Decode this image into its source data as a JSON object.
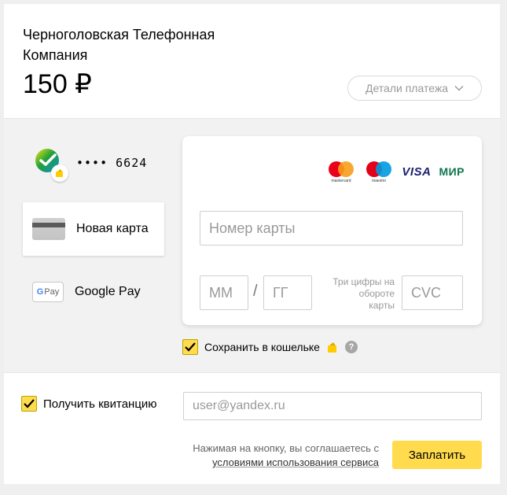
{
  "header": {
    "merchant_name": "Черноголовская Телефонная Компания",
    "amount": "150 ₽",
    "details_label": "Детали платежа"
  },
  "methods": {
    "saved_card": {
      "mask": "•••• 6624",
      "icon": "sberbank-icon"
    },
    "new_card": {
      "label": "Новая карта",
      "icon": "bank-card-icon"
    },
    "google_pay": {
      "label": "Google Pay",
      "icon_text": "Pay",
      "icon": "google-pay-icon"
    }
  },
  "card_form": {
    "brands": {
      "mastercard": "mastercard",
      "maestro": "maestro",
      "visa": "VISA",
      "mir": "МИР"
    },
    "number_placeholder": "Номер карты",
    "month_placeholder": "ММ",
    "separator": "/",
    "year_placeholder": "ГГ",
    "cvc_hint": "Три цифры на обороте карты",
    "cvc_placeholder": "CVC"
  },
  "save_wallet": {
    "label": "Сохранить в кошельке",
    "checked": true,
    "help": "?"
  },
  "receipt": {
    "label": "Получить квитанцию",
    "checked": true,
    "email_placeholder": "user@yandex.ru"
  },
  "footer": {
    "agree_text": "Нажимая на кнопку, вы соглашаетесь с",
    "terms_link": "условиями использования сервиса",
    "pay_label": "Заплатить"
  },
  "colors": {
    "accent": "#ffdb4d",
    "background": "#f2f2f2",
    "sber_green": "#21a038"
  }
}
